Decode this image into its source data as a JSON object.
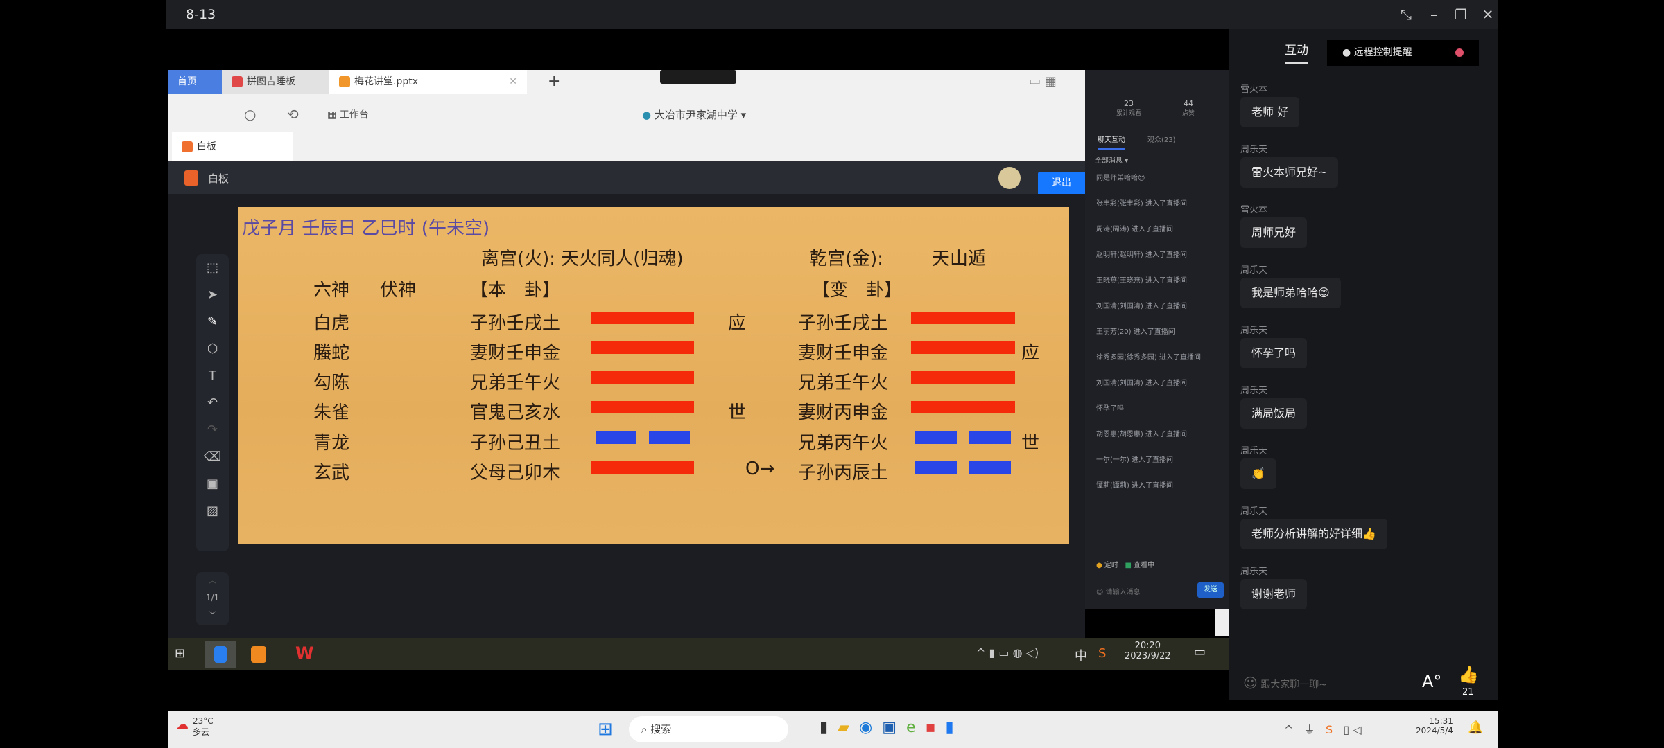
{
  "window": {
    "title": "8-13"
  },
  "browser": {
    "tabs": [
      {
        "label": "首页"
      },
      {
        "label": "拼图吉睡板"
      },
      {
        "label": "梅花讲堂.pptx"
      }
    ],
    "add_tab": "+",
    "workspace": "工作台",
    "school": "大冶市尹家湖中学",
    "sub_tab": "白板"
  },
  "whiteboard": {
    "title": "白板",
    "exit_label": "退出",
    "page": "1/1"
  },
  "slide": {
    "header": "戊子月 壬辰日 乙巳时 (午未空)",
    "ben_palace": "离宫(火): 天火同人(归魂)",
    "bian_palace": "乾宫(金):",
    "bian_name": "天山遁",
    "col_liushen": "六神",
    "col_fushen": "伏神",
    "col_ben": "【本　卦】",
    "col_bian": "【变　卦】",
    "colors": {
      "yang": "#f42a0a",
      "yin": "#2a46e6",
      "header": "#5b4aa3"
    },
    "rows": [
      {
        "liushen": "白虎",
        "ben": "子孙壬戌土",
        "ben_line": "yang",
        "ben_mark": "应",
        "moving": "",
        "bian": "子孙壬戌土",
        "bian_line": "yang",
        "bian_mark": ""
      },
      {
        "liushen": "螣蛇",
        "ben": "妻财壬申金",
        "ben_line": "yang",
        "ben_mark": "",
        "moving": "",
        "bian": "妻财壬申金",
        "bian_line": "yang",
        "bian_mark": "应"
      },
      {
        "liushen": "勾陈",
        "ben": "兄弟壬午火",
        "ben_line": "yang",
        "ben_mark": "",
        "moving": "",
        "bian": "兄弟壬午火",
        "bian_line": "yang",
        "bian_mark": ""
      },
      {
        "liushen": "朱雀",
        "ben": "官鬼己亥水",
        "ben_line": "yang",
        "ben_mark": "世",
        "moving": "",
        "bian": "妻财丙申金",
        "bian_line": "yang",
        "bian_mark": ""
      },
      {
        "liushen": "青龙",
        "ben": "子孙己丑土",
        "ben_line": "yin",
        "ben_mark": "",
        "moving": "",
        "bian": "兄弟丙午火",
        "bian_line": "yin",
        "bian_mark": "世"
      },
      {
        "liushen": "玄武",
        "ben": "父母己卯木",
        "ben_line": "yang",
        "ben_mark": "",
        "moving": "O→",
        "bian": "子孙丙辰土",
        "bian_line": "yin",
        "bian_mark": ""
      }
    ]
  },
  "midpanel": {
    "stat1": "23",
    "stat1_label": "累计观看",
    "stat2": "44",
    "stat2_label": "点赞",
    "tab1": "聊天互动",
    "tab2": "观众(23)",
    "filter": "全部消息",
    "items": [
      "同是师弟哈哈😊",
      "张丰彩(张丰彩) 进入了直播间",
      "周涛(周涛) 进入了直播间",
      "赵明轩(赵明轩) 进入了直播间",
      "王晓燕(王晓燕) 进入了直播间",
      "刘国清(刘国清) 进入了直播间",
      "王丽芳(20) 进入了直播间",
      "徐秀多园(徐秀多园) 进入了直播间",
      "刘国清(刘国清) 进入了直播间",
      "怀孕了吗",
      "胡恩惠(胡恩惠) 进入了直播间",
      "一尔(一尔) 进入了直播间",
      "谭莉(谭莉) 进入了直播间"
    ],
    "foot1": "定时",
    "foot2": "查看中",
    "input_placeholder": "请输入消息",
    "send": "发送"
  },
  "wintask": {
    "ime": "中",
    "time": "20:20",
    "date": "2023/9/22"
  },
  "chat": {
    "tab": "互动",
    "remote": "远程控制提醒",
    "input_placeholder": "跟大家聊一聊~",
    "font_btn": "A°",
    "likes": "21",
    "messages": [
      {
        "name": "雷火本",
        "text": "老师 好"
      },
      {
        "name": "周乐天",
        "text": "雷火本师兄好~"
      },
      {
        "name": "雷火本",
        "text": "周师兄好"
      },
      {
        "name": "周乐天",
        "text": "我是师弟哈哈😊"
      },
      {
        "name": "周乐天",
        "text": "怀孕了吗"
      },
      {
        "name": "周乐天",
        "text": "满局饭局"
      },
      {
        "name": "周乐天",
        "text": "👏"
      },
      {
        "name": "周乐天",
        "text": "老师分析讲解的好详细👍"
      },
      {
        "name": "周乐天",
        "text": "谢谢老师"
      }
    ]
  },
  "taskbar": {
    "temp": "23°C",
    "weather": "多云",
    "search": "搜索",
    "time": "15:31",
    "date": "2024/5/4"
  }
}
